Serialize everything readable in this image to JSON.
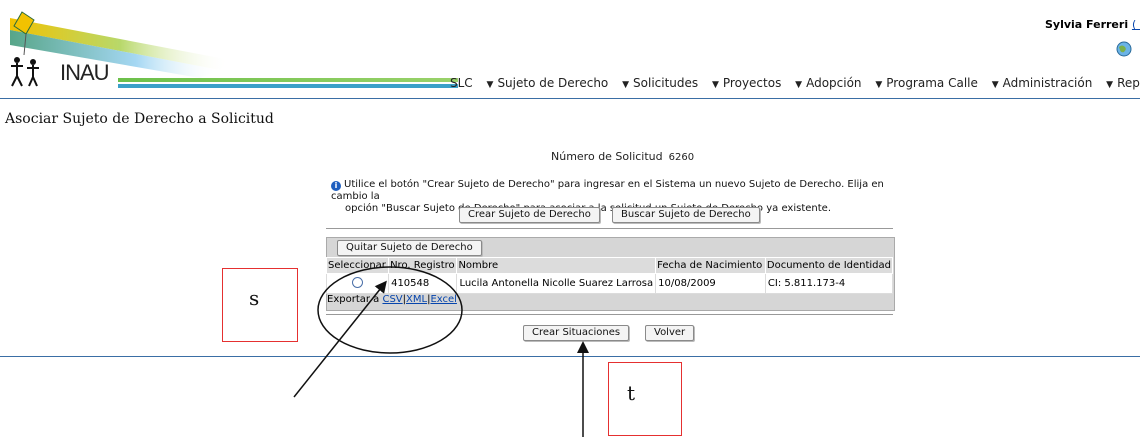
{
  "header": {
    "user_name": "Sylvia Ferreri",
    "user_link": "( Ce",
    "logo_text": "INAU",
    "nav": [
      {
        "label": "SLC"
      },
      {
        "label": "Sujeto de Derecho"
      },
      {
        "label": "Solicitudes"
      },
      {
        "label": "Proyectos"
      },
      {
        "label": "Adopción"
      },
      {
        "label": "Programa Calle"
      },
      {
        "label": "Administración"
      },
      {
        "label": "Report"
      }
    ]
  },
  "page": {
    "title": "Asociar Sujeto de Derecho a Solicitud",
    "solicitud_label": "Número de Solicitud",
    "solicitud_value": "6260",
    "info_line1": "Utilice el botón \"Crear Sujeto de Derecho\" para ingresar en el Sistema un nuevo Sujeto de Derecho. Elija en cambio la",
    "info_line2": "opción \"Buscar Sujeto de Derecho\" para asociar a la solicitud un Sujeto de Derecho ya existente.",
    "btn_crear_sujeto": "Crear Sujeto de Derecho",
    "btn_buscar_sujeto": "Buscar Sujeto de Derecho",
    "btn_quitar": "Quitar Sujeto de Derecho",
    "btn_crear_situaciones": "Crear Situaciones",
    "btn_volver": "Volver"
  },
  "table": {
    "columns": [
      "Seleccionar",
      "Nro. Registro",
      "Nombre",
      "Fecha de Nacimiento",
      "Documento de Identidad"
    ],
    "rows": [
      {
        "registro": "410548",
        "nombre": "Lucila Antonella Nicolle Suarez Larrosa",
        "fecha": "10/08/2009",
        "documento": "CI: 5.811.173-4"
      }
    ],
    "export_label": "Exportar a",
    "export_csv": "CSV",
    "export_xml": "XML",
    "export_excel": "Excel"
  },
  "annotations": {
    "label_s": "s",
    "label_t": "t"
  },
  "colors": {
    "accent_blue": "#3a6ea5",
    "annotation_red": "#e53030"
  }
}
